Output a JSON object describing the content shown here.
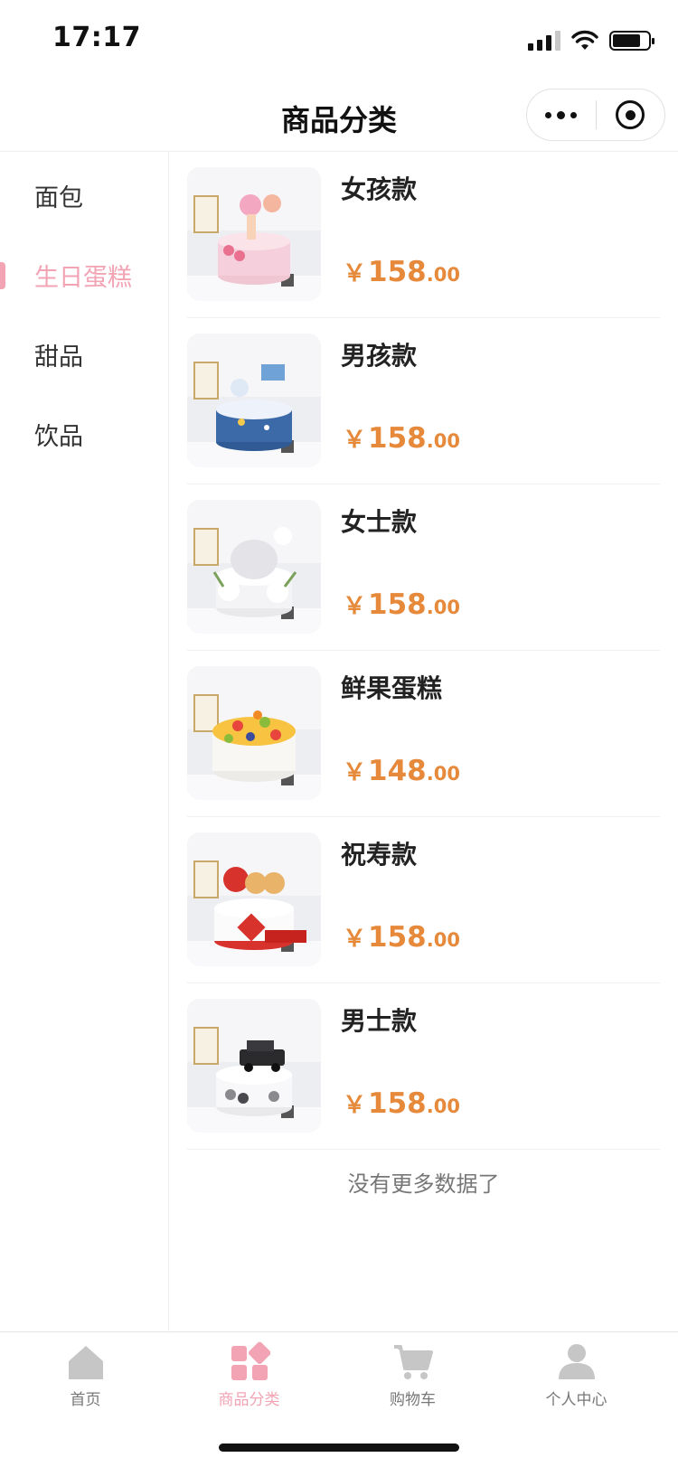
{
  "status_bar": {
    "time": "17:17",
    "battery_level": 0.8
  },
  "nav": {
    "title": "商品分类"
  },
  "sidebar": {
    "items": [
      {
        "label": "面包",
        "active": false
      },
      {
        "label": "生日蛋糕",
        "active": true
      },
      {
        "label": "甜品",
        "active": false
      },
      {
        "label": "饮品",
        "active": false
      }
    ]
  },
  "products": [
    {
      "name": "女孩款",
      "currency": "￥",
      "price_int": "158",
      "price_dec": ".00",
      "image": "pink-princess-cake"
    },
    {
      "name": "男孩款",
      "currency": "￥",
      "price_int": "158",
      "price_dec": ".00",
      "image": "blue-space-cake"
    },
    {
      "name": "女士款",
      "currency": "￥",
      "price_int": "158",
      "price_dec": ".00",
      "image": "white-flower-cake"
    },
    {
      "name": "鲜果蛋糕",
      "currency": "￥",
      "price_int": "148",
      "price_dec": ".00",
      "image": "fresh-fruit-cake"
    },
    {
      "name": "祝寿款",
      "currency": "￥",
      "price_int": "158",
      "price_dec": ".00",
      "image": "red-longevity-cake"
    },
    {
      "name": "男士款",
      "currency": "￥",
      "price_int": "158",
      "price_dec": ".00",
      "image": "car-topper-cake"
    }
  ],
  "list_end_text": "没有更多数据了",
  "tab_bar": {
    "tabs": [
      {
        "label": "首页",
        "icon": "home-icon",
        "active": false
      },
      {
        "label": "商品分类",
        "icon": "category-icon",
        "active": true
      },
      {
        "label": "购物车",
        "icon": "cart-icon",
        "active": false
      },
      {
        "label": "个人中心",
        "icon": "user-icon",
        "active": false
      }
    ]
  },
  "colors": {
    "accent": "#f2a4b4",
    "price": "#e6893b",
    "tab_inactive": "#c6c6c6"
  }
}
